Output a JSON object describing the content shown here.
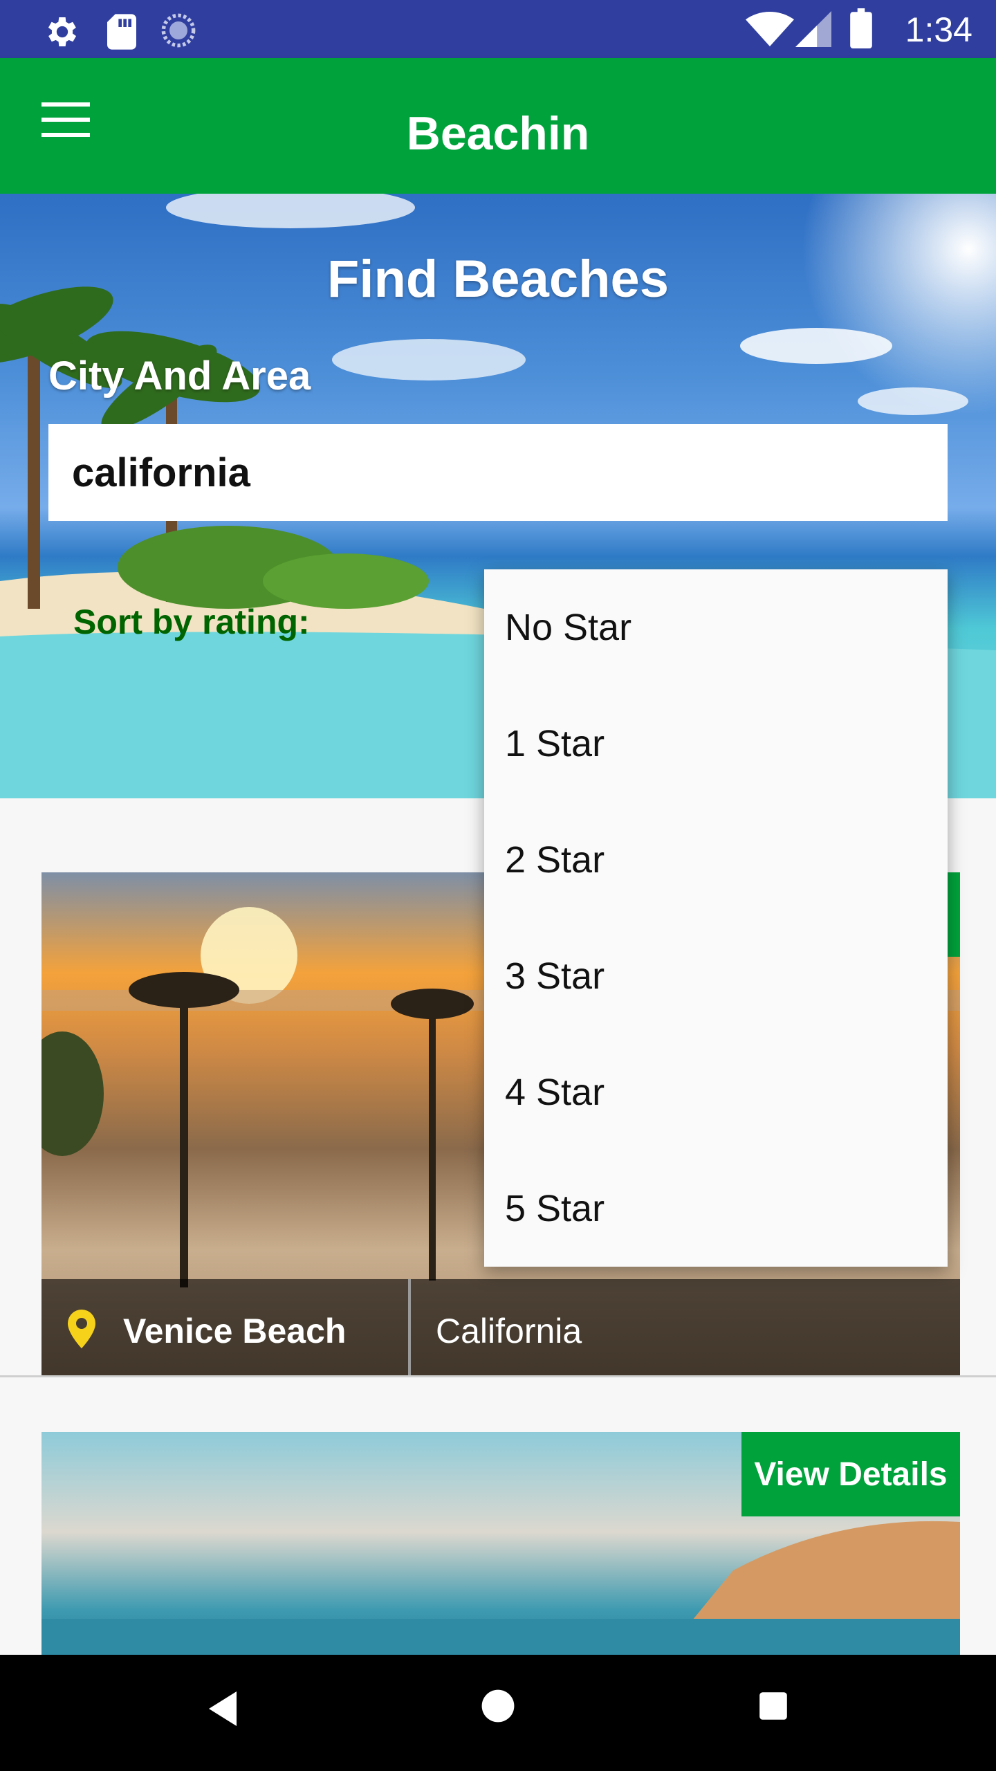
{
  "status_bar": {
    "time": "1:34",
    "icons_left": [
      "gear-icon",
      "sd-card-icon",
      "sync-icon"
    ],
    "icons_right": [
      "wifi-icon",
      "signal-icon",
      "battery-icon"
    ]
  },
  "app_bar": {
    "title": "Beachin",
    "menu_icon": "hamburger-menu-icon"
  },
  "hero": {
    "title": "Find Beaches",
    "city_label": "City And Area",
    "city_value": "california",
    "sort_label": "Sort by rating:"
  },
  "dropdown": {
    "options": [
      "No Star",
      "1 Star",
      "2 Star",
      "3 Star",
      "4 Star",
      "5 Star"
    ]
  },
  "cards": [
    {
      "name": "Venice Beach",
      "region": "California",
      "view_label": ""
    },
    {
      "name": "",
      "region": "",
      "view_label": "View Details"
    }
  ],
  "colors": {
    "status_bar": "#303f9f",
    "app_bar": "#00a33b",
    "sort_label": "#006400",
    "pin": "#f7d21b"
  },
  "nav_bar": {
    "icons": [
      "back-icon",
      "home-icon",
      "recents-icon"
    ]
  }
}
